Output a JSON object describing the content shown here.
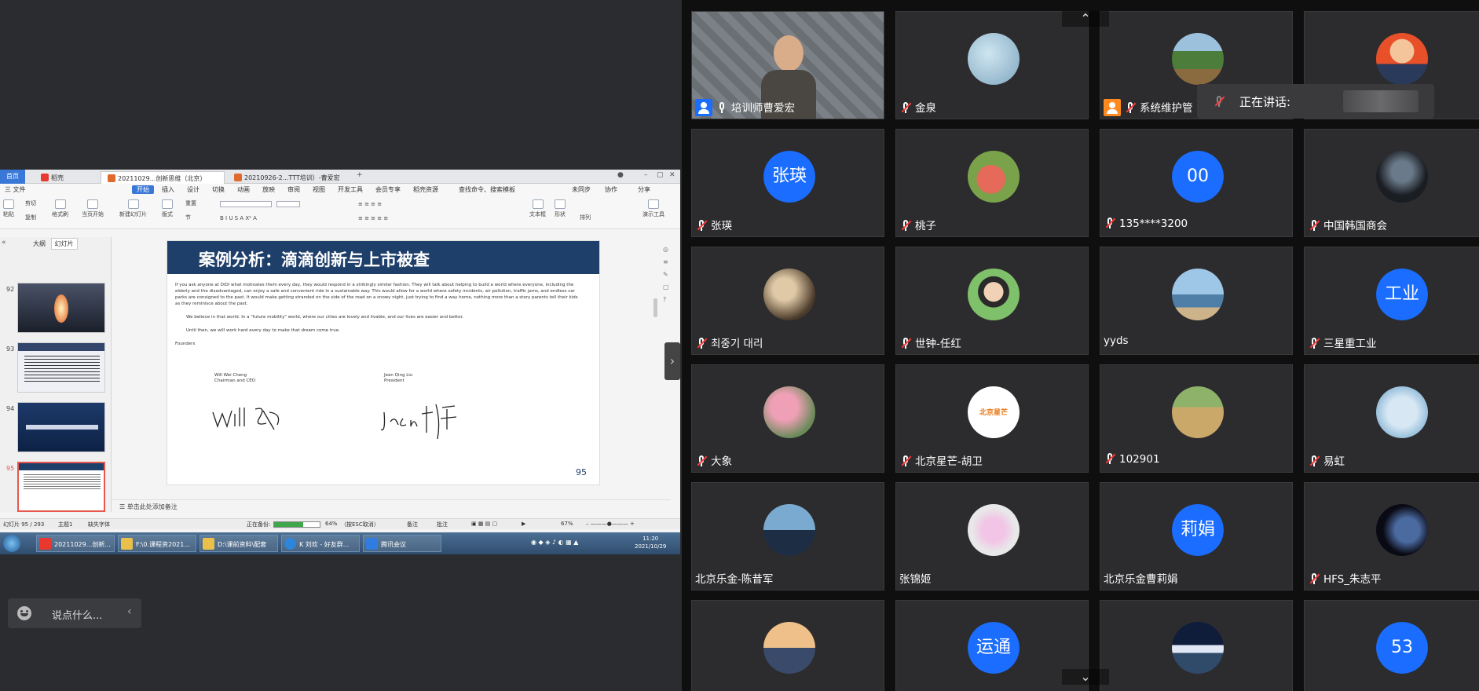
{
  "wps": {
    "tabs": [
      {
        "label": "首页"
      },
      {
        "label": "稻壳"
      },
      {
        "label": "20211029...创新思维（北京）"
      },
      {
        "label": "20210926-2...TTT培训）-曹爱宏"
      }
    ],
    "menu": [
      "三 文件",
      "开始",
      "插入",
      "设计",
      "切换",
      "动画",
      "放映",
      "审阅",
      "视图",
      "开发工具",
      "会员专享",
      "稻壳资源",
      "查找命令、搜索模板",
      "未同步",
      "协作",
      "分享"
    ],
    "ribbon": [
      "粘贴",
      "剪切",
      "复制",
      "格式刷",
      "当页开始",
      "新建幻灯片",
      "版式",
      "节",
      "重置",
      "文本框",
      "形状",
      "排列",
      "演示工具"
    ],
    "panel_tabs": [
      "大纲",
      "幻灯片"
    ],
    "thumbnails": [
      {
        "num": "92",
        "color": "#2d3547"
      },
      {
        "num": "93",
        "color": "#33456a"
      },
      {
        "num": "94",
        "color": "#1d3a6a"
      },
      {
        "num": "95",
        "color": "#ffffff"
      }
    ],
    "slide": {
      "title": "案例分析：滴滴创新与上市被查",
      "paragraph1": "If you ask anyone at DiDi what motivates them every day, they would respond in a strikingly similar fashion. They will talk about helping to build a world where everyone, including the elderly and the disadvantaged, can enjoy a safe and convenient ride in a sustainable way. This would allow for a world where safety incidents, air pollution, traffic jams, and endless car parks are consigned to the past. It would make getting stranded on the side of the road on a snowy night, just trying to find a way home, nothing more than a story parents tell their kids as they reminisce about the past.",
      "paragraph2": "We believe in that world. In a \"future mobility\" world, where our cities are lovely and livable, and our lives are easier and better.",
      "paragraph3": "Until then, we will work hard every day to make that dream come true.",
      "founders_label": "Founders",
      "signer1_name": "Will Wei Cheng",
      "signer1_title": "Chairman and CEO",
      "signer2_name": "Jean Qing Liu",
      "signer2_title": "President",
      "page_number": "95"
    },
    "notes_placeholder": "单击此处添加备注",
    "status": {
      "slide_count": "幻灯片 95 / 293",
      "theme": "主题1",
      "font_missing": "缺失字体",
      "backup_label": "正在备份:",
      "backup_percent": "64%",
      "backup_progress": 0.64,
      "cancel_hint": "（按ESC取消）",
      "notes": "备注",
      "comments": "批注",
      "zoom": "67%"
    },
    "taskbar": {
      "items": [
        "20211029...创新...",
        "F:\\0.课程资2021...",
        "D:\\课前资料\\配套",
        "K 刘欢 - 好友群...",
        "腾讯会议"
      ],
      "time": "11:20",
      "date": "2021/10/29"
    }
  },
  "chat": {
    "placeholder": "说点什么..."
  },
  "speaking": {
    "label": "正在讲话:"
  },
  "participants": [
    {
      "name": "培训师曹爱宏",
      "avatar_text": "",
      "avatar_kind": "video",
      "muted": false,
      "badge": "host"
    },
    {
      "name": "金泉",
      "avatar_text": "",
      "avatar_kind": "sky",
      "muted": true,
      "badge": ""
    },
    {
      "name": "系统维护管",
      "avatar_text": "",
      "avatar_kind": "field",
      "muted": true,
      "badge": "cohost"
    },
    {
      "name": "",
      "avatar_text": "",
      "avatar_kind": "cartoon",
      "muted": false,
      "badge": ""
    },
    {
      "name": "张瑛",
      "avatar_text": "张瑛",
      "avatar_kind": "text",
      "muted": true,
      "badge": ""
    },
    {
      "name": "桃子",
      "avatar_text": "",
      "avatar_kind": "peach",
      "muted": true,
      "badge": ""
    },
    {
      "name": "135****3200",
      "avatar_text": "00",
      "avatar_kind": "text",
      "muted": true,
      "badge": ""
    },
    {
      "name": "中国韩国商会",
      "avatar_text": "",
      "avatar_kind": "dark",
      "muted": true,
      "badge": ""
    },
    {
      "name": "최중기 대리",
      "avatar_text": "",
      "avatar_kind": "room",
      "muted": true,
      "badge": ""
    },
    {
      "name": "世钟-任红",
      "avatar_text": "",
      "avatar_kind": "woman",
      "muted": true,
      "badge": ""
    },
    {
      "name": "yyds",
      "avatar_text": "",
      "avatar_kind": "sea",
      "muted": false,
      "badge": ""
    },
    {
      "name": "三星重工业",
      "avatar_text": "工业",
      "avatar_kind": "text",
      "muted": true,
      "badge": ""
    },
    {
      "name": "大象",
      "avatar_text": "",
      "avatar_kind": "blossom",
      "muted": true,
      "badge": ""
    },
    {
      "name": "北京星芒-胡卫",
      "avatar_text": "北京星芒",
      "avatar_kind": "logo",
      "muted": true,
      "badge": ""
    },
    {
      "name": "102901",
      "avatar_text": "",
      "avatar_kind": "kids",
      "muted": true,
      "badge": ""
    },
    {
      "name": "易虹",
      "avatar_text": "",
      "avatar_kind": "baby",
      "muted": true,
      "badge": ""
    },
    {
      "name": "北京乐金-陈昔军",
      "avatar_text": "",
      "avatar_kind": "penguin",
      "muted": false,
      "badge": ""
    },
    {
      "name": "张锦姬",
      "avatar_text": "",
      "avatar_kind": "flower",
      "muted": false,
      "badge": ""
    },
    {
      "name": "北京乐金曹莉娟",
      "avatar_text": "莉娟",
      "avatar_kind": "text",
      "muted": false,
      "badge": ""
    },
    {
      "name": "HFS_朱志平",
      "avatar_text": "",
      "avatar_kind": "earth",
      "muted": true,
      "badge": ""
    },
    {
      "name": "",
      "avatar_text": "",
      "avatar_kind": "city",
      "muted": false,
      "badge": ""
    },
    {
      "name": "",
      "avatar_text": "运通",
      "avatar_kind": "text",
      "muted": false,
      "badge": ""
    },
    {
      "name": "",
      "avatar_text": "",
      "avatar_kind": "mountain",
      "muted": false,
      "badge": ""
    },
    {
      "name": "",
      "avatar_text": "53",
      "avatar_kind": "text",
      "muted": false,
      "badge": ""
    }
  ],
  "colors": {
    "accent": "#1a6dff",
    "tile_bg": "#2c2c2e",
    "muted_red": "#ff3b3b"
  }
}
